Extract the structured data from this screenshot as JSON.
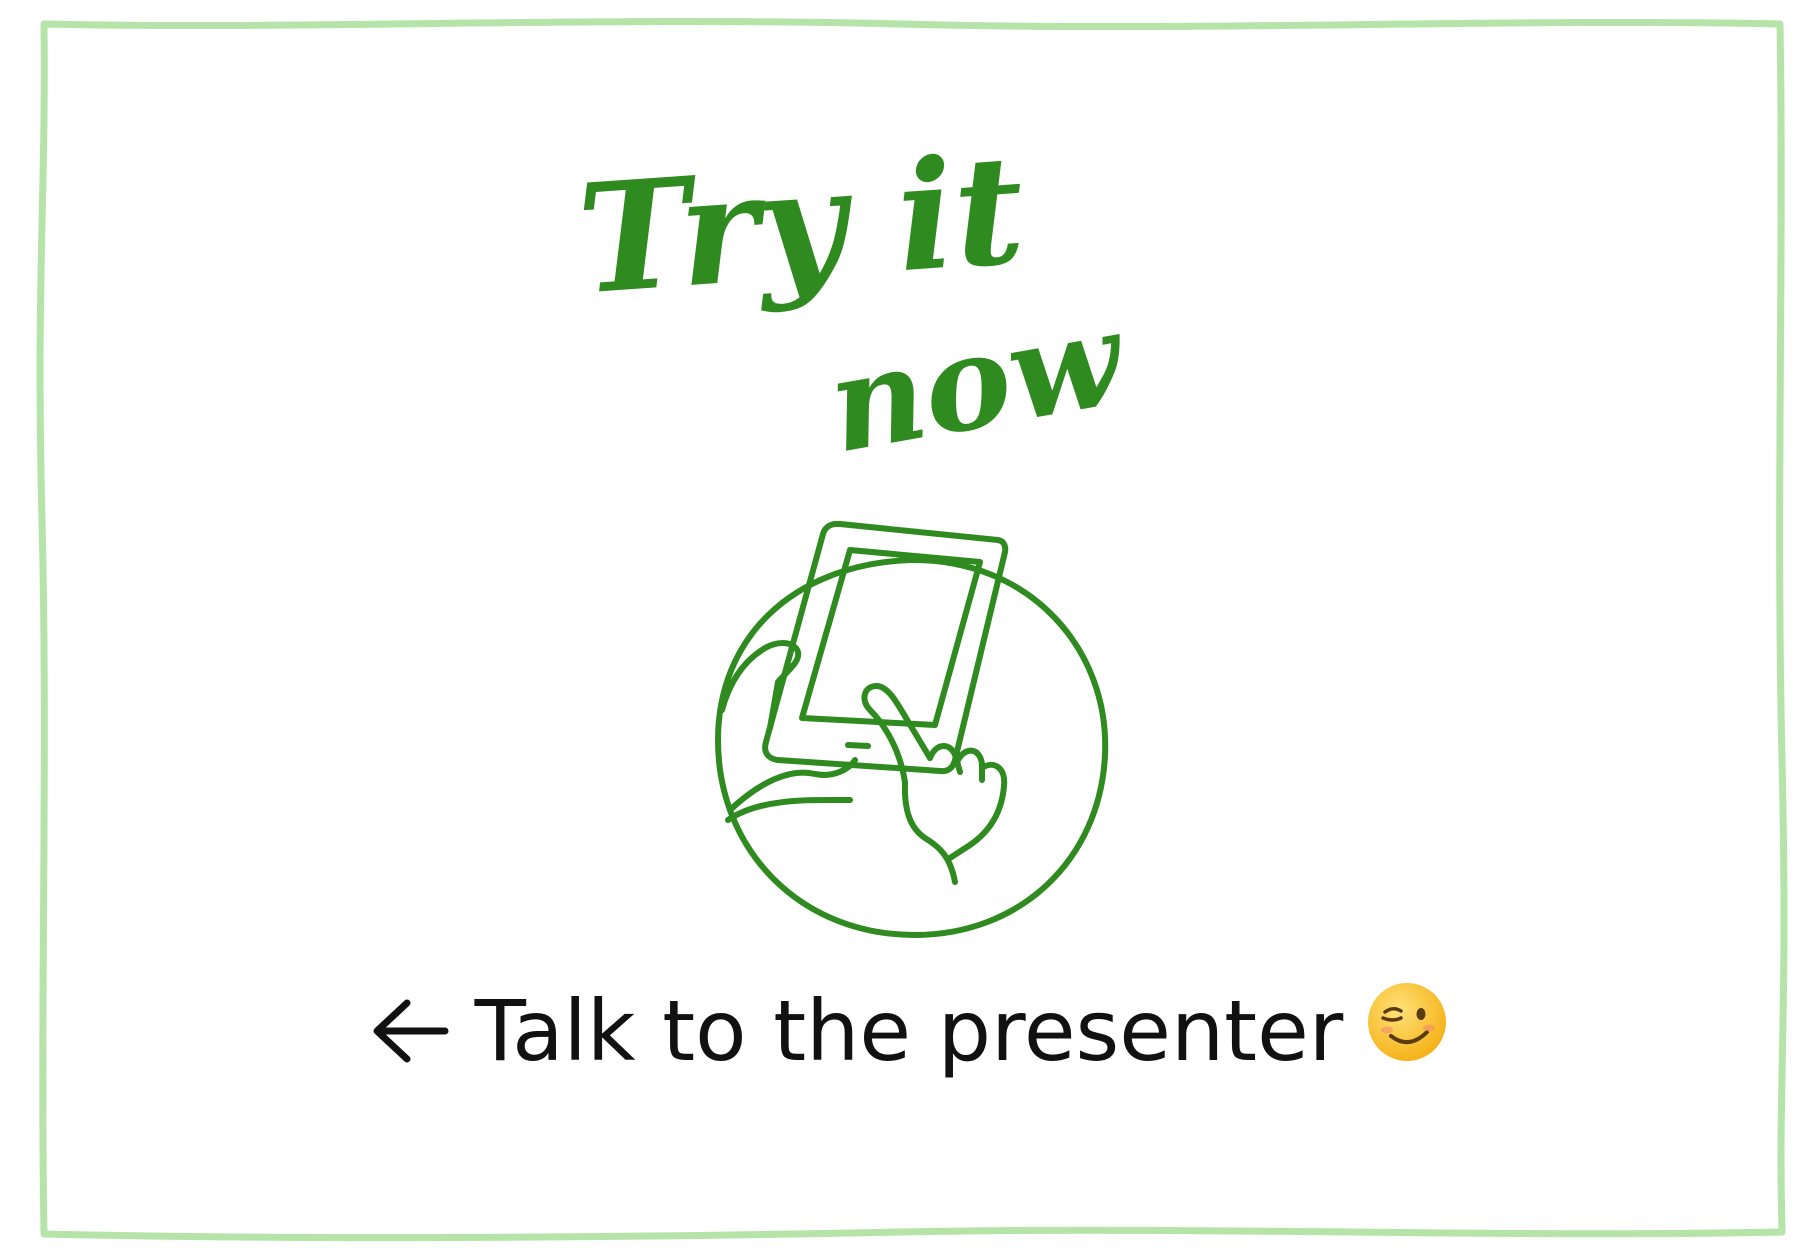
{
  "headline": {
    "line1": "Try it",
    "line2": "now"
  },
  "caption": {
    "arrow_icon": "arrow-left-icon",
    "text": "Talk to the presenter",
    "emoji_icon": "winking-face-icon"
  },
  "illustration": {
    "icon": "hands-holding-tablet-icon"
  },
  "colors": {
    "frame": "#b6e3a8",
    "accent": "#2f8a1f",
    "text": "#111111"
  }
}
